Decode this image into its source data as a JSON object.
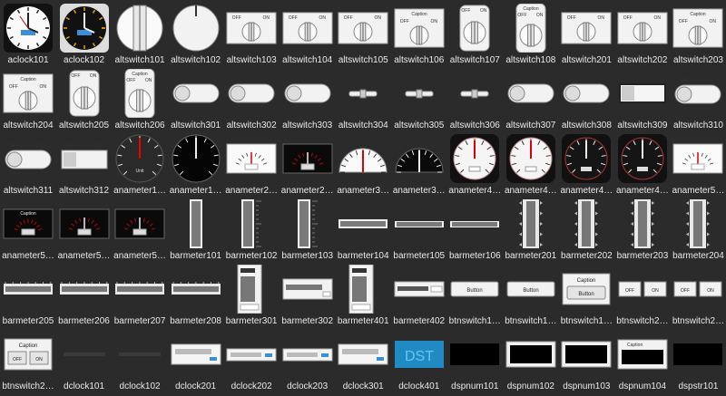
{
  "widgets": [
    {
      "label": "aclock101",
      "icon": "analog-clock-white-icon",
      "kind": "clock-white"
    },
    {
      "label": "aclock102",
      "icon": "analog-clock-dark-icon",
      "kind": "clock-dark"
    },
    {
      "label": "altswitch101",
      "icon": "rotary-switch-icon",
      "kind": "knob-bar"
    },
    {
      "label": "altswitch102",
      "icon": "rotary-knob-icon",
      "kind": "knob-notch"
    },
    {
      "label": "altswitch103",
      "icon": "rotary-switch-panel-icon",
      "kind": "panel-knob"
    },
    {
      "label": "altswitch104",
      "icon": "rotary-switch-panel-icon",
      "kind": "panel-knob"
    },
    {
      "label": "altswitch105",
      "icon": "rotary-switch-panel-icon",
      "kind": "panel-knob"
    },
    {
      "label": "altswitch106",
      "icon": "rotary-switch-caption-icon",
      "kind": "panel-knob-caption"
    },
    {
      "label": "altswitch107",
      "icon": "rotary-switch-tall-icon",
      "kind": "tall-knob"
    },
    {
      "label": "altswitch108",
      "icon": "rotary-switch-tall-caption-icon",
      "kind": "tall-knob-caption"
    },
    {
      "label": "altswitch201",
      "icon": "rotary-switch-panel-icon",
      "kind": "panel-knob"
    },
    {
      "label": "altswitch202",
      "icon": "rotary-switch-panel-icon",
      "kind": "panel-knob"
    },
    {
      "label": "altswitch203",
      "icon": "rotary-switch-caption-icon",
      "kind": "panel-knob-caption"
    },
    {
      "label": "altswitch204",
      "icon": "rotary-switch-caption-icon",
      "kind": "panel-knob-caption"
    },
    {
      "label": "altswitch205",
      "icon": "rotary-switch-tall-icon",
      "kind": "tall-knob"
    },
    {
      "label": "altswitch206",
      "icon": "rotary-switch-tall-caption-icon",
      "kind": "tall-knob-caption"
    },
    {
      "label": "altswitch301",
      "icon": "toggle-pill-icon",
      "kind": "pill"
    },
    {
      "label": "altswitch302",
      "icon": "toggle-pill-icon",
      "kind": "pill"
    },
    {
      "label": "altswitch303",
      "icon": "toggle-pill-icon",
      "kind": "pill"
    },
    {
      "label": "altswitch304",
      "icon": "slide-switch-icon",
      "kind": "slim"
    },
    {
      "label": "altswitch305",
      "icon": "slide-switch-icon",
      "kind": "slim"
    },
    {
      "label": "altswitch306",
      "icon": "slide-switch-icon",
      "kind": "slim"
    },
    {
      "label": "altswitch307",
      "icon": "toggle-pill-icon",
      "kind": "pill"
    },
    {
      "label": "altswitch308",
      "icon": "toggle-pill-icon",
      "kind": "pill"
    },
    {
      "label": "altswitch309",
      "icon": "toggle-rect-icon",
      "kind": "rect-toggle"
    },
    {
      "label": "altswitch310",
      "icon": "toggle-pill-onoff-icon",
      "kind": "pill-onoff"
    },
    {
      "label": "altswitch311",
      "icon": "toggle-pill-onoff-icon",
      "kind": "pill-onoff"
    },
    {
      "label": "altswitch312",
      "icon": "toggle-rect-onoff-icon",
      "kind": "rect-onoff"
    },
    {
      "label": "anameter1…",
      "icon": "analog-meter-dark-icon",
      "kind": "meter-dark-red"
    },
    {
      "label": "anameter1…",
      "icon": "analog-meter-black-icon",
      "kind": "meter-black"
    },
    {
      "label": "anameter2…",
      "icon": "panel-meter-white-icon",
      "kind": "panel-meter-white"
    },
    {
      "label": "anameter2…",
      "icon": "panel-meter-black-icon",
      "kind": "panel-meter-black"
    },
    {
      "label": "anameter3…",
      "icon": "semicircle-meter-white-icon",
      "kind": "semi-white"
    },
    {
      "label": "anameter3…",
      "icon": "semicircle-meter-black-icon",
      "kind": "semi-black"
    },
    {
      "label": "anameter4…",
      "icon": "round-meter-icon",
      "kind": "round-meter"
    },
    {
      "label": "anameter4…",
      "icon": "round-meter-icon",
      "kind": "round-meter"
    },
    {
      "label": "anameter4…",
      "icon": "round-meter-dark-icon",
      "kind": "round-meter-dark"
    },
    {
      "label": "anameter4…",
      "icon": "round-meter-dark-icon",
      "kind": "round-meter-dark"
    },
    {
      "label": "anameter5…",
      "icon": "panel-meter-caption-icon",
      "kind": "panel-meter-white"
    },
    {
      "label": "anameter5…",
      "icon": "panel-meter-caption-icon",
      "kind": "panel-meter-caption"
    },
    {
      "label": "anameter5…",
      "icon": "panel-meter-black-icon",
      "kind": "panel-meter-black"
    },
    {
      "label": "anameter5…",
      "icon": "panel-meter-black-icon",
      "kind": "panel-meter-black"
    },
    {
      "label": "barmeter101",
      "icon": "vertical-bar-meter-icon",
      "kind": "vbar"
    },
    {
      "label": "barmeter102",
      "icon": "vertical-bar-meter-scale-icon",
      "kind": "vbar-scale"
    },
    {
      "label": "barmeter103",
      "icon": "vertical-bar-meter-scale-icon",
      "kind": "vbar-scale"
    },
    {
      "label": "barmeter104",
      "icon": "horizontal-bar-meter-icon",
      "kind": "hbar"
    },
    {
      "label": "barmeter105",
      "icon": "horizontal-bar-meter-icon",
      "kind": "hbar-thin"
    },
    {
      "label": "barmeter106",
      "icon": "horizontal-bar-meter-icon",
      "kind": "hbar-thin"
    },
    {
      "label": "barmeter201",
      "icon": "vertical-bar-meter-ticks-icon",
      "kind": "vbar-ticks"
    },
    {
      "label": "barmeter202",
      "icon": "vertical-bar-meter-ticks-icon",
      "kind": "vbar-ticks"
    },
    {
      "label": "barmeter203",
      "icon": "vertical-bar-meter-ticks-icon",
      "kind": "vbar-ticks"
    },
    {
      "label": "barmeter204",
      "icon": "vertical-bar-meter-ticks-icon",
      "kind": "vbar-ticks"
    },
    {
      "label": "barmeter205",
      "icon": "horizontal-bar-meter-ticks-icon",
      "kind": "hbar-ticks"
    },
    {
      "label": "barmeter206",
      "icon": "horizontal-bar-meter-ticks-icon",
      "kind": "hbar-ticks"
    },
    {
      "label": "barmeter207",
      "icon": "horizontal-bar-meter-ticks-icon",
      "kind": "hbar-ticks"
    },
    {
      "label": "barmeter208",
      "icon": "horizontal-bar-meter-ticks-icon",
      "kind": "hbar-ticks"
    },
    {
      "label": "barmeter301",
      "icon": "bar-meter-panel-icon",
      "kind": "panel-vbar"
    },
    {
      "label": "barmeter302",
      "icon": "bar-meter-panel-icon",
      "kind": "panel-hbar"
    },
    {
      "label": "barmeter401",
      "icon": "bar-meter-panel-icon",
      "kind": "panel-vbar"
    },
    {
      "label": "barmeter402",
      "icon": "bar-meter-panel-icon",
      "kind": "panel-hbar-small"
    },
    {
      "label": "btnswitch1…",
      "icon": "push-button-icon",
      "kind": "button"
    },
    {
      "label": "btnswitch1…",
      "icon": "push-button-icon",
      "kind": "button"
    },
    {
      "label": "btnswitch1…",
      "icon": "caption-button-icon",
      "kind": "caption-button"
    },
    {
      "label": "btnswitch2…",
      "icon": "off-on-buttons-icon",
      "kind": "offon"
    },
    {
      "label": "btnswitch2…",
      "icon": "off-on-buttons-icon",
      "kind": "offon"
    },
    {
      "label": "btnswitch2…",
      "icon": "caption-off-on-icon",
      "kind": "caption-offon"
    },
    {
      "label": "dclock101",
      "icon": "digital-clock-icon",
      "kind": "text-dark"
    },
    {
      "label": "dclock102",
      "icon": "digital-clock-icon",
      "kind": "text-dark"
    },
    {
      "label": "dclock201",
      "icon": "digital-clock-panel-icon",
      "kind": "dclock-panel"
    },
    {
      "label": "dclock202",
      "icon": "digital-clock-panel-icon",
      "kind": "dclock-panel-small"
    },
    {
      "label": "dclock203",
      "icon": "digital-clock-panel-icon",
      "kind": "dclock-panel-small"
    },
    {
      "label": "dclock301",
      "icon": "digital-clock-panel-icon",
      "kind": "dclock-panel"
    },
    {
      "label": "dclock401",
      "icon": "dst-display-icon",
      "kind": "dst"
    },
    {
      "label": "dspnum101",
      "icon": "numeric-display-icon",
      "kind": "dspnum"
    },
    {
      "label": "dspnum102",
      "icon": "numeric-display-framed-icon",
      "kind": "dspnum-framed"
    },
    {
      "label": "dspnum103",
      "icon": "numeric-display-framed-icon",
      "kind": "dspnum-framed"
    },
    {
      "label": "dspnum104",
      "icon": "numeric-display-caption-icon",
      "kind": "dspnum-caption"
    },
    {
      "label": "dspstr101",
      "icon": "string-display-icon",
      "kind": "dspstr"
    }
  ],
  "text": {
    "caption": "Caption",
    "off": "OFF",
    "on": "ON",
    "unit": "Unit",
    "button": "Button",
    "dst": "DST"
  }
}
